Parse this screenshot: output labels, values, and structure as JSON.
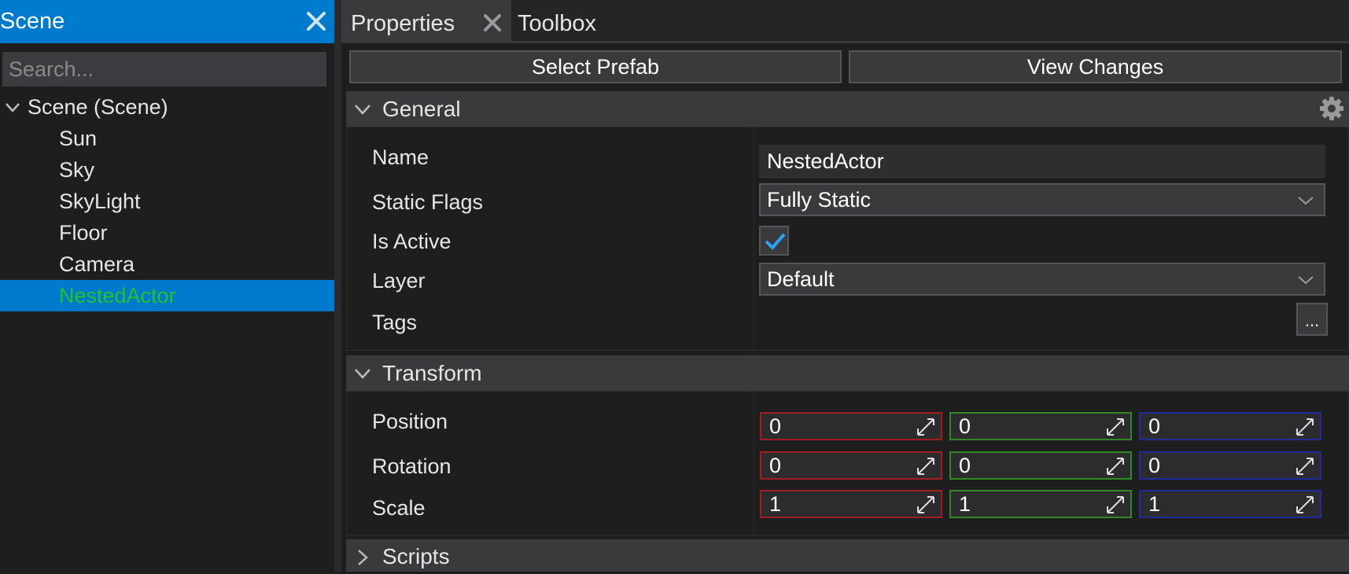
{
  "scene_panel": {
    "title": "Scene",
    "search_placeholder": "Search...",
    "tree": [
      {
        "label": "Scene (Scene)",
        "level": 0,
        "expanded": true
      },
      {
        "label": "Sun",
        "level": 1
      },
      {
        "label": "Sky",
        "level": 1
      },
      {
        "label": "SkyLight",
        "level": 1
      },
      {
        "label": "Floor",
        "level": 1
      },
      {
        "label": "Camera",
        "level": 1
      },
      {
        "label": "NestedActor",
        "level": 1,
        "selected": true
      }
    ]
  },
  "tabs": [
    {
      "label": "Properties",
      "active": true
    },
    {
      "label": "Toolbox",
      "active": false
    }
  ],
  "toolbar": {
    "select_prefab": "Select Prefab",
    "view_changes": "View Changes"
  },
  "general": {
    "title": "General",
    "name_label": "Name",
    "name_value": "NestedActor",
    "static_flags_label": "Static Flags",
    "static_flags_value": "Fully Static",
    "is_active_label": "Is Active",
    "is_active_checked": true,
    "layer_label": "Layer",
    "layer_value": "Default",
    "tags_label": "Tags",
    "tags_button": "..."
  },
  "transform": {
    "title": "Transform",
    "position_label": "Position",
    "position": [
      "0",
      "0",
      "0"
    ],
    "rotation_label": "Rotation",
    "rotation": [
      "0",
      "0",
      "0"
    ],
    "scale_label": "Scale",
    "scale": [
      "1",
      "1",
      "1"
    ]
  },
  "scripts": {
    "title": "Scripts"
  },
  "colors": {
    "accent": "#007acc",
    "selected_text": "#22c42b",
    "axis_x": "#a01d22",
    "axis_y": "#2f8a24",
    "axis_z": "#1f2d9c",
    "checkmark": "#2aa3f0"
  },
  "icons": [
    "close-icon",
    "chevron-down-icon",
    "chevron-right-icon",
    "gear-icon",
    "checkmark-icon",
    "slide-arrows-icon"
  ]
}
